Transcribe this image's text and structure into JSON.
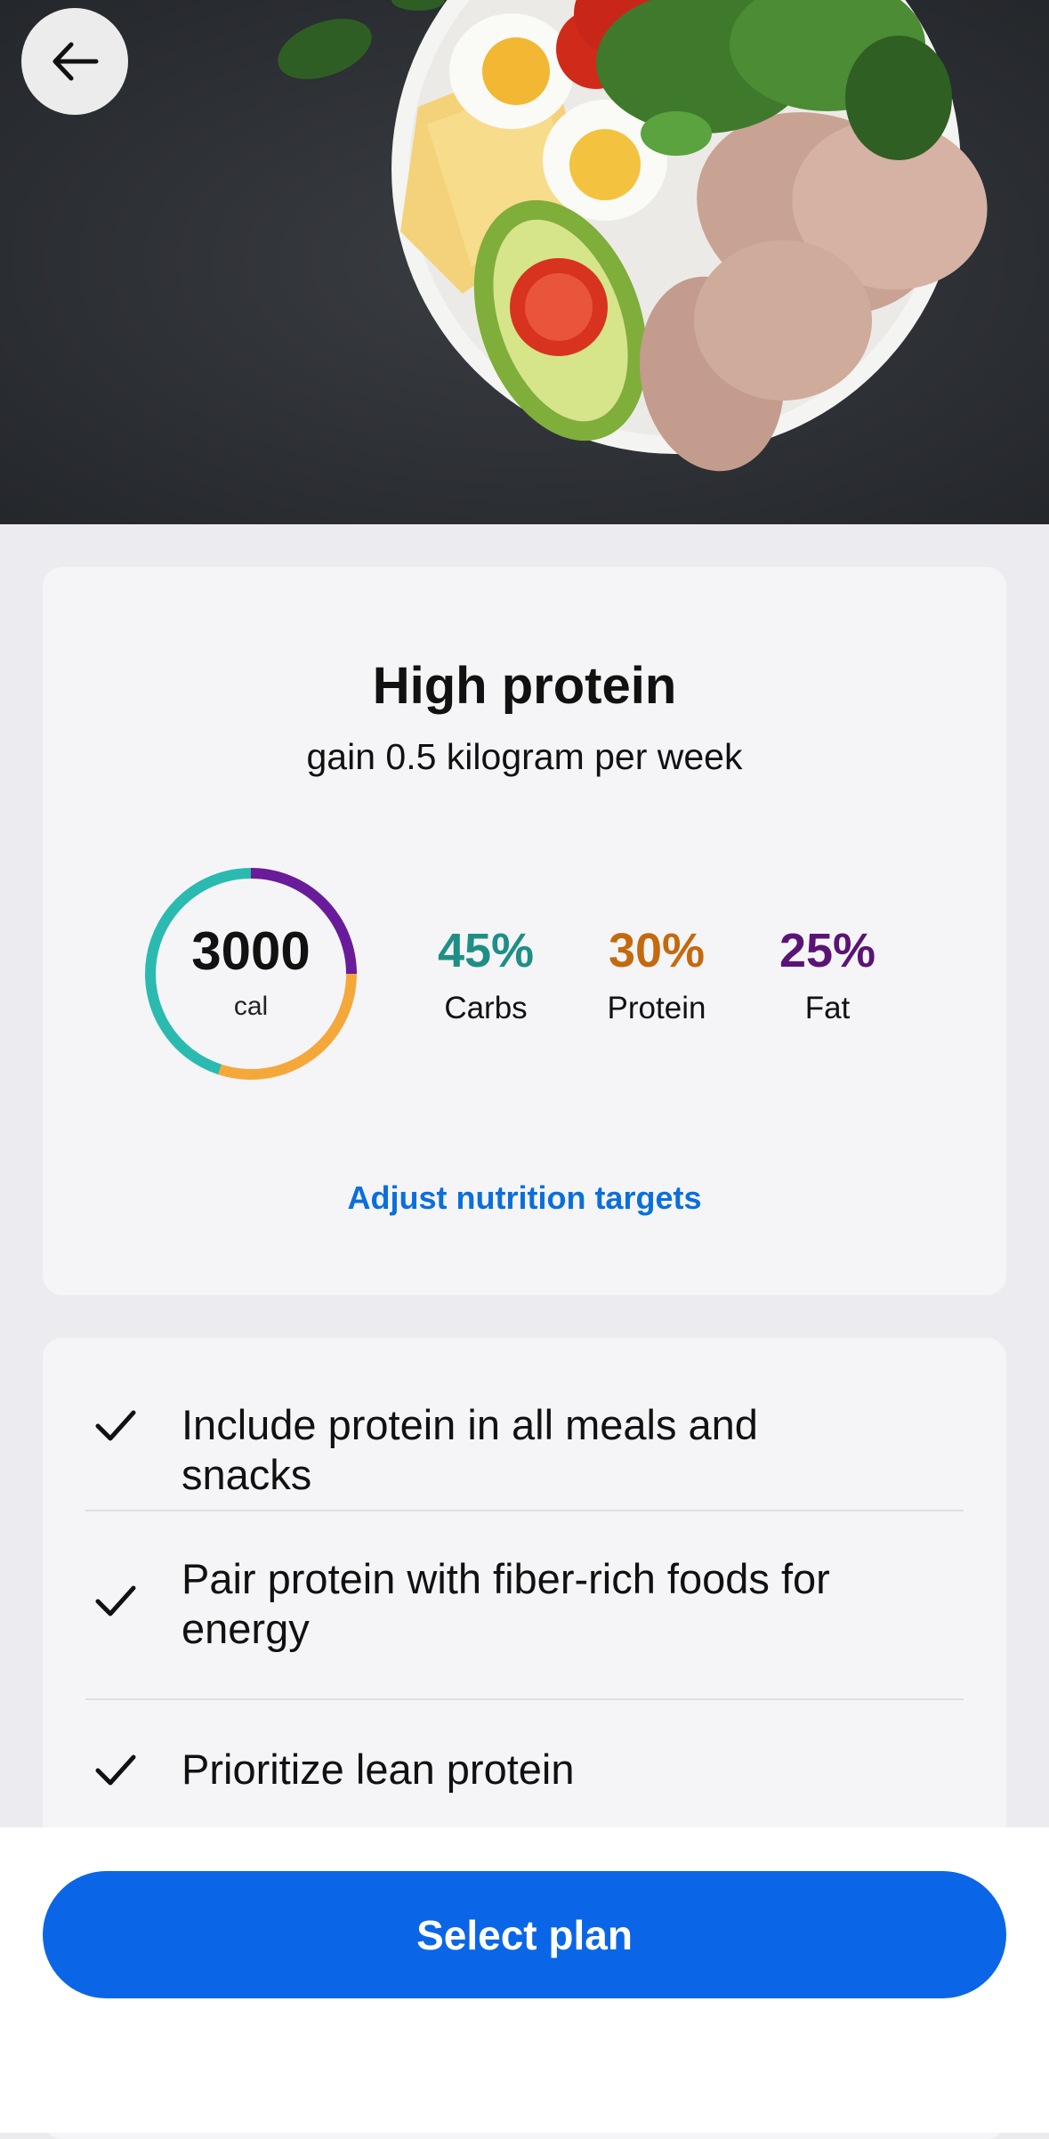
{
  "header": {
    "back_icon": "arrow-left-icon",
    "hero_image": "salad-bowl-photo"
  },
  "plan": {
    "title": "High protein",
    "subtitle": "gain 0.5 kilogram per week",
    "calories": {
      "value": "3000",
      "unit": "cal"
    },
    "macros": [
      {
        "percent": "45%",
        "label": "Carbs",
        "color": "#2bbab0",
        "fraction": 0.45
      },
      {
        "percent": "30%",
        "label": "Protein",
        "color": "#f5a83a",
        "fraction": 0.3
      },
      {
        "percent": "25%",
        "label": "Fat",
        "color": "#6a1b9a",
        "fraction": 0.25
      }
    ],
    "macro_text_colors": [
      "#1f8f86",
      "#c46a0e",
      "#5b1475"
    ],
    "adjust_link": "Adjust nutrition targets"
  },
  "tips": [
    {
      "text": "Include protein in all meals and snacks",
      "icon": "checkmark-icon"
    },
    {
      "text": "Pair protein with fiber-rich foods for energy",
      "icon": "checkmark-icon"
    },
    {
      "text": "Prioritize lean protein",
      "icon": "checkmark-icon"
    }
  ],
  "footer": {
    "select_label": "Select plan",
    "accent": "#0a66e6"
  }
}
